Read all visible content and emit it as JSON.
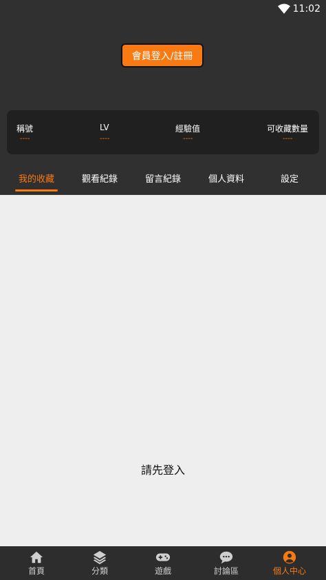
{
  "status_bar": {
    "time": "11:02",
    "wifi_icon": "wifi-icon"
  },
  "header": {
    "login_button": "會員登入/註冊"
  },
  "stats": [
    {
      "label": "稱號",
      "value": "----"
    },
    {
      "label": "LV",
      "value": "----"
    },
    {
      "label": "經驗值",
      "value": "----"
    },
    {
      "label": "可收藏數量",
      "value": "----"
    }
  ],
  "tabs": [
    {
      "label": "我的收藏",
      "active": true
    },
    {
      "label": "觀看紀錄",
      "active": false
    },
    {
      "label": "留言紀錄",
      "active": false
    },
    {
      "label": "個人資料",
      "active": false
    },
    {
      "label": "設定",
      "active": false
    }
  ],
  "content": {
    "message": "請先登入"
  },
  "bottom_nav": [
    {
      "label": "首頁",
      "icon": "home-icon"
    },
    {
      "label": "分類",
      "icon": "layers-icon"
    },
    {
      "label": "遊戲",
      "icon": "gamepad-icon"
    },
    {
      "label": "討論區",
      "icon": "chat-icon"
    },
    {
      "label": "個人中心",
      "icon": "user-circle-icon",
      "active": true
    }
  ],
  "colors": {
    "accent": "#f97a12",
    "background": "#303030",
    "panel": "#202020",
    "content_bg": "#eeeeee"
  }
}
